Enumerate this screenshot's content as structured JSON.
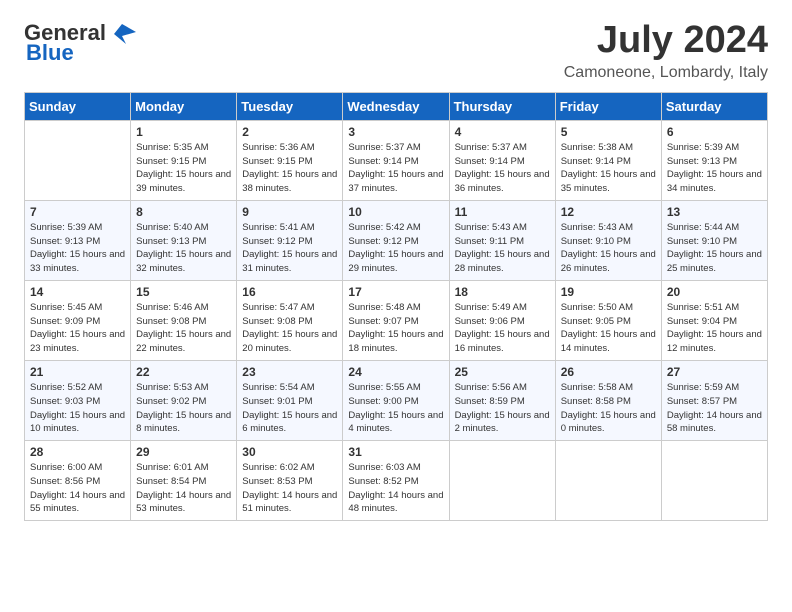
{
  "logo": {
    "line1": "General",
    "line2": "Blue"
  },
  "title": "July 2024",
  "location": "Camoneone, Lombardy, Italy",
  "days_of_week": [
    "Sunday",
    "Monday",
    "Tuesday",
    "Wednesday",
    "Thursday",
    "Friday",
    "Saturday"
  ],
  "weeks": [
    [
      {
        "day": "",
        "sunrise": "",
        "sunset": "",
        "daylight": ""
      },
      {
        "day": "1",
        "sunrise": "Sunrise: 5:35 AM",
        "sunset": "Sunset: 9:15 PM",
        "daylight": "Daylight: 15 hours and 39 minutes."
      },
      {
        "day": "2",
        "sunrise": "Sunrise: 5:36 AM",
        "sunset": "Sunset: 9:15 PM",
        "daylight": "Daylight: 15 hours and 38 minutes."
      },
      {
        "day": "3",
        "sunrise": "Sunrise: 5:37 AM",
        "sunset": "Sunset: 9:14 PM",
        "daylight": "Daylight: 15 hours and 37 minutes."
      },
      {
        "day": "4",
        "sunrise": "Sunrise: 5:37 AM",
        "sunset": "Sunset: 9:14 PM",
        "daylight": "Daylight: 15 hours and 36 minutes."
      },
      {
        "day": "5",
        "sunrise": "Sunrise: 5:38 AM",
        "sunset": "Sunset: 9:14 PM",
        "daylight": "Daylight: 15 hours and 35 minutes."
      },
      {
        "day": "6",
        "sunrise": "Sunrise: 5:39 AM",
        "sunset": "Sunset: 9:13 PM",
        "daylight": "Daylight: 15 hours and 34 minutes."
      }
    ],
    [
      {
        "day": "7",
        "sunrise": "Sunrise: 5:39 AM",
        "sunset": "Sunset: 9:13 PM",
        "daylight": "Daylight: 15 hours and 33 minutes."
      },
      {
        "day": "8",
        "sunrise": "Sunrise: 5:40 AM",
        "sunset": "Sunset: 9:13 PM",
        "daylight": "Daylight: 15 hours and 32 minutes."
      },
      {
        "day": "9",
        "sunrise": "Sunrise: 5:41 AM",
        "sunset": "Sunset: 9:12 PM",
        "daylight": "Daylight: 15 hours and 31 minutes."
      },
      {
        "day": "10",
        "sunrise": "Sunrise: 5:42 AM",
        "sunset": "Sunset: 9:12 PM",
        "daylight": "Daylight: 15 hours and 29 minutes."
      },
      {
        "day": "11",
        "sunrise": "Sunrise: 5:43 AM",
        "sunset": "Sunset: 9:11 PM",
        "daylight": "Daylight: 15 hours and 28 minutes."
      },
      {
        "day": "12",
        "sunrise": "Sunrise: 5:43 AM",
        "sunset": "Sunset: 9:10 PM",
        "daylight": "Daylight: 15 hours and 26 minutes."
      },
      {
        "day": "13",
        "sunrise": "Sunrise: 5:44 AM",
        "sunset": "Sunset: 9:10 PM",
        "daylight": "Daylight: 15 hours and 25 minutes."
      }
    ],
    [
      {
        "day": "14",
        "sunrise": "Sunrise: 5:45 AM",
        "sunset": "Sunset: 9:09 PM",
        "daylight": "Daylight: 15 hours and 23 minutes."
      },
      {
        "day": "15",
        "sunrise": "Sunrise: 5:46 AM",
        "sunset": "Sunset: 9:08 PM",
        "daylight": "Daylight: 15 hours and 22 minutes."
      },
      {
        "day": "16",
        "sunrise": "Sunrise: 5:47 AM",
        "sunset": "Sunset: 9:08 PM",
        "daylight": "Daylight: 15 hours and 20 minutes."
      },
      {
        "day": "17",
        "sunrise": "Sunrise: 5:48 AM",
        "sunset": "Sunset: 9:07 PM",
        "daylight": "Daylight: 15 hours and 18 minutes."
      },
      {
        "day": "18",
        "sunrise": "Sunrise: 5:49 AM",
        "sunset": "Sunset: 9:06 PM",
        "daylight": "Daylight: 15 hours and 16 minutes."
      },
      {
        "day": "19",
        "sunrise": "Sunrise: 5:50 AM",
        "sunset": "Sunset: 9:05 PM",
        "daylight": "Daylight: 15 hours and 14 minutes."
      },
      {
        "day": "20",
        "sunrise": "Sunrise: 5:51 AM",
        "sunset": "Sunset: 9:04 PM",
        "daylight": "Daylight: 15 hours and 12 minutes."
      }
    ],
    [
      {
        "day": "21",
        "sunrise": "Sunrise: 5:52 AM",
        "sunset": "Sunset: 9:03 PM",
        "daylight": "Daylight: 15 hours and 10 minutes."
      },
      {
        "day": "22",
        "sunrise": "Sunrise: 5:53 AM",
        "sunset": "Sunset: 9:02 PM",
        "daylight": "Daylight: 15 hours and 8 minutes."
      },
      {
        "day": "23",
        "sunrise": "Sunrise: 5:54 AM",
        "sunset": "Sunset: 9:01 PM",
        "daylight": "Daylight: 15 hours and 6 minutes."
      },
      {
        "day": "24",
        "sunrise": "Sunrise: 5:55 AM",
        "sunset": "Sunset: 9:00 PM",
        "daylight": "Daylight: 15 hours and 4 minutes."
      },
      {
        "day": "25",
        "sunrise": "Sunrise: 5:56 AM",
        "sunset": "Sunset: 8:59 PM",
        "daylight": "Daylight: 15 hours and 2 minutes."
      },
      {
        "day": "26",
        "sunrise": "Sunrise: 5:58 AM",
        "sunset": "Sunset: 8:58 PM",
        "daylight": "Daylight: 15 hours and 0 minutes."
      },
      {
        "day": "27",
        "sunrise": "Sunrise: 5:59 AM",
        "sunset": "Sunset: 8:57 PM",
        "daylight": "Daylight: 14 hours and 58 minutes."
      }
    ],
    [
      {
        "day": "28",
        "sunrise": "Sunrise: 6:00 AM",
        "sunset": "Sunset: 8:56 PM",
        "daylight": "Daylight: 14 hours and 55 minutes."
      },
      {
        "day": "29",
        "sunrise": "Sunrise: 6:01 AM",
        "sunset": "Sunset: 8:54 PM",
        "daylight": "Daylight: 14 hours and 53 minutes."
      },
      {
        "day": "30",
        "sunrise": "Sunrise: 6:02 AM",
        "sunset": "Sunset: 8:53 PM",
        "daylight": "Daylight: 14 hours and 51 minutes."
      },
      {
        "day": "31",
        "sunrise": "Sunrise: 6:03 AM",
        "sunset": "Sunset: 8:52 PM",
        "daylight": "Daylight: 14 hours and 48 minutes."
      },
      {
        "day": "",
        "sunrise": "",
        "sunset": "",
        "daylight": ""
      },
      {
        "day": "",
        "sunrise": "",
        "sunset": "",
        "daylight": ""
      },
      {
        "day": "",
        "sunrise": "",
        "sunset": "",
        "daylight": ""
      }
    ]
  ]
}
